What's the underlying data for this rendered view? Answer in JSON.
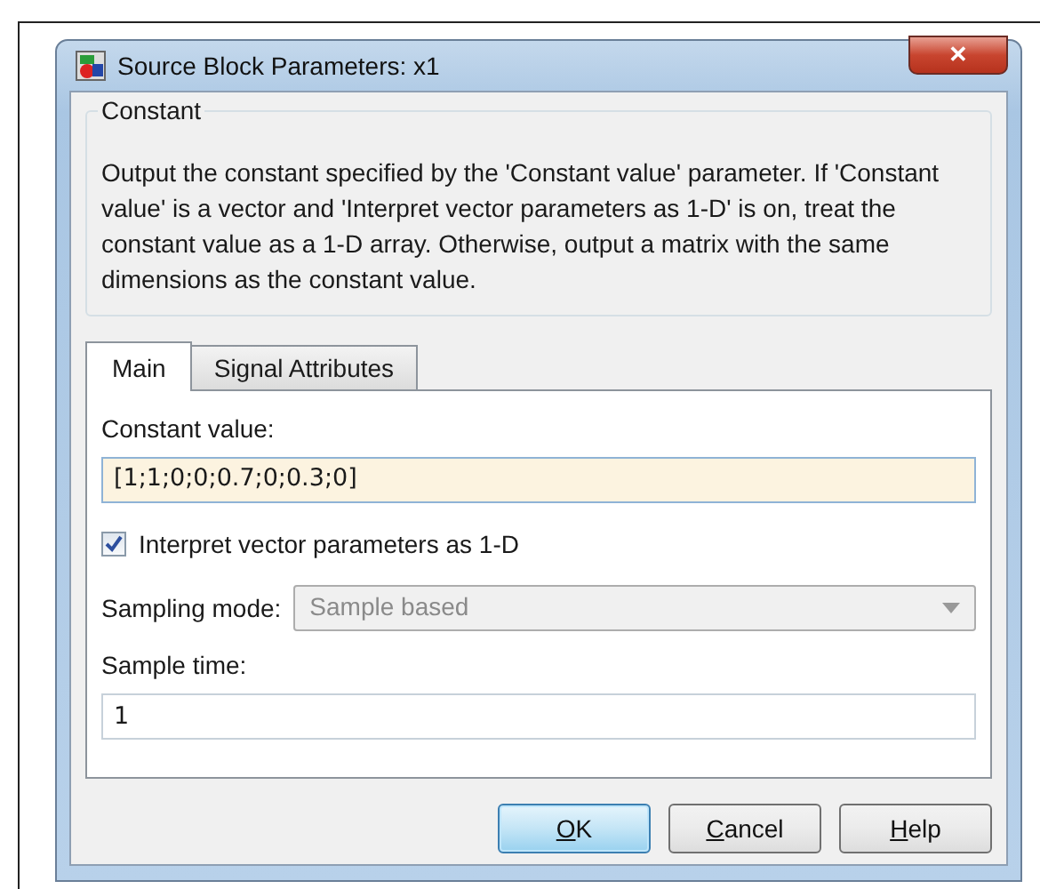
{
  "window": {
    "title": "Source Block Parameters: x1",
    "close": "✕"
  },
  "group": {
    "title": "Constant",
    "description": "Output the constant specified by the 'Constant value' parameter. If 'Constant value' is a vector and 'Interpret vector parameters as 1-D' is on, treat the constant value as a 1-D array. Otherwise, output a matrix with the same dimensions as the constant value."
  },
  "tabs": [
    {
      "label": "Main",
      "selected": true
    },
    {
      "label": "Signal Attributes",
      "selected": false
    }
  ],
  "fields": [
    {
      "kind": "text",
      "label": "Constant value:",
      "value": "[1;1;0;0;0.7;0;0.3;0]",
      "focused": true
    },
    {
      "kind": "checkbox",
      "label": "Interpret vector parameters as 1-D",
      "checked": true
    },
    {
      "kind": "select",
      "label": "Sampling mode:",
      "value": "Sample based",
      "disabled": true
    },
    {
      "kind": "text",
      "label": "Sample time:",
      "value": "1",
      "focused": false
    }
  ],
  "buttons": [
    {
      "accel": "O",
      "rest": "K",
      "default": true
    },
    {
      "accel": "C",
      "rest": "ancel",
      "default": false
    },
    {
      "accel": "H",
      "rest": "elp",
      "default": false
    }
  ]
}
